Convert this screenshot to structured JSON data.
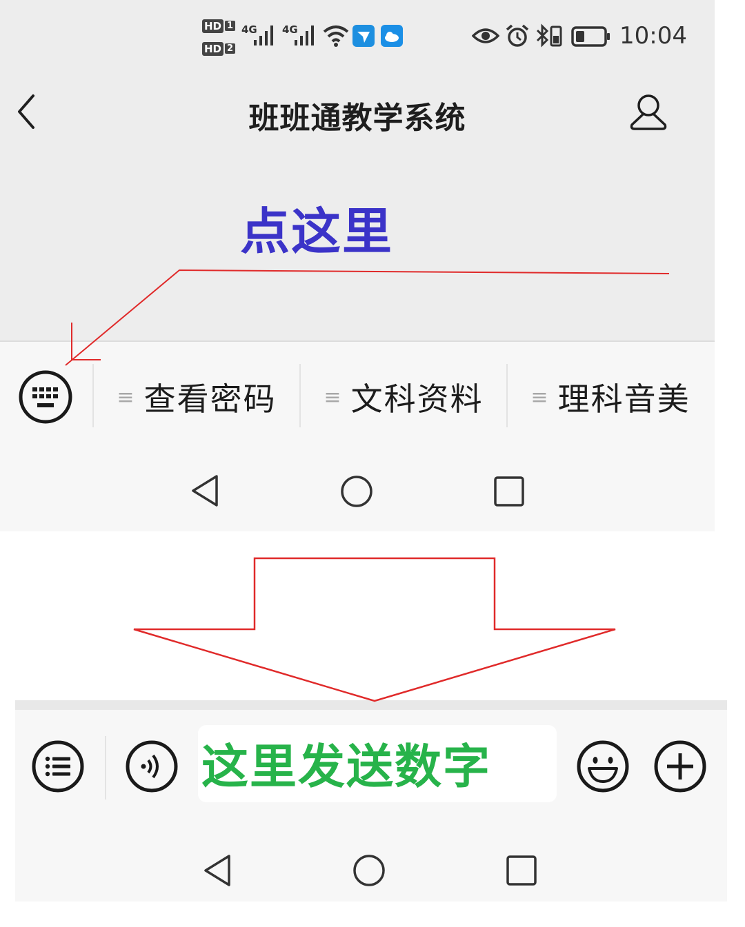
{
  "status_bar": {
    "hd1": "HD",
    "sim1": "1",
    "hd2": "HD",
    "sim2": "2",
    "net1": "4G",
    "net2": "4G",
    "time": "10:04"
  },
  "header": {
    "title": "班班通教学系统"
  },
  "annotations": {
    "click_here": "点这里",
    "send_number_here": "这里发送数字",
    "click_color": "#3b33c8",
    "send_color": "#27b34a",
    "arrow_color": "#e02a2a"
  },
  "menu": {
    "items": [
      {
        "label": "查看密码"
      },
      {
        "label": "文科资料"
      },
      {
        "label": "理科音美"
      }
    ]
  },
  "icons": {
    "back": "chevron-left-icon",
    "profile": "user-icon",
    "keyboard": "keyboard-icon",
    "menu_list": "list-icon",
    "voice": "voice-icon",
    "emoji": "emoji-icon",
    "add": "plus-icon",
    "nav_back": "triangle-back-icon",
    "nav_home": "circle-home-icon",
    "nav_recent": "square-recent-icon"
  }
}
